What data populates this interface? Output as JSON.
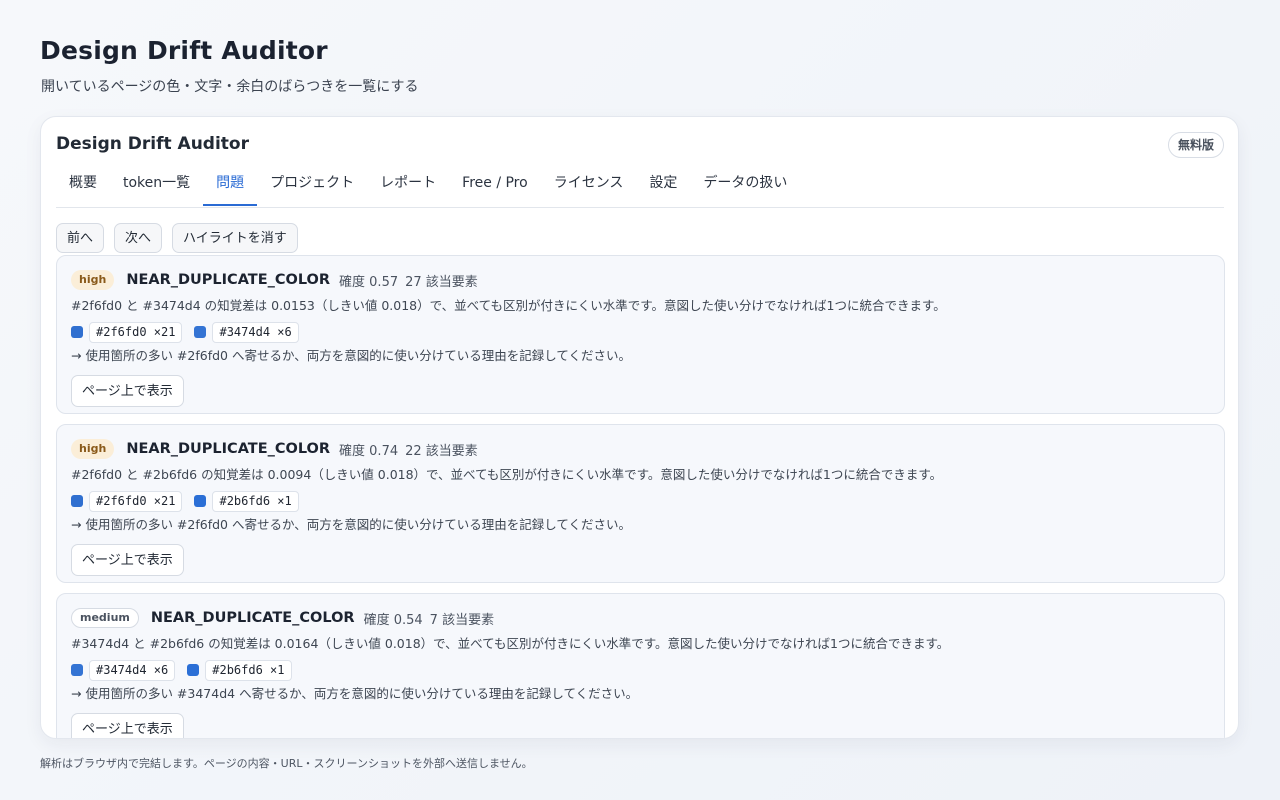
{
  "header": {
    "title": "Design Drift Auditor",
    "subtitle": "開いているページの色・文字・余白のばらつきを一覧にする"
  },
  "panel": {
    "title": "Design Drift Auditor",
    "plan_badge": "無料版",
    "tabs": [
      {
        "label": "概要"
      },
      {
        "label": "token一覧"
      },
      {
        "label": "問題",
        "active": true
      },
      {
        "label": "プロジェクト"
      },
      {
        "label": "レポート"
      },
      {
        "label": "Free / Pro"
      },
      {
        "label": "ライセンス"
      },
      {
        "label": "設定"
      },
      {
        "label": "データの扱い"
      }
    ],
    "toolbar": {
      "prev": "前へ",
      "next": "次へ",
      "clear_highlight": "ハイライトを消す"
    }
  },
  "issues": [
    {
      "severity": "high",
      "code": "NEAR_DUPLICATE_COLOR",
      "confidence": "確度 0.57",
      "elements": "27 該当要素",
      "description": "#2f6fd0 と #3474d4 の知覚差は 0.0153（しきい値 0.018）で、並べても区別が付きにくい水準です。意図した使い分けでなければ1つに統合できます。",
      "colors": [
        {
          "hex": "#2f6fd0",
          "label": "#2f6fd0 ×21",
          "swatch": "#2f6fd0"
        },
        {
          "hex": "#3474d4",
          "label": "#3474d4 ×6",
          "swatch": "#3474d4"
        }
      ],
      "suggestion": "→ 使用箇所の多い #2f6fd0 へ寄せるか、両方を意図的に使い分けている理由を記録してください。",
      "show_button": "ページ上で表示"
    },
    {
      "severity": "high",
      "code": "NEAR_DUPLICATE_COLOR",
      "confidence": "確度 0.74",
      "elements": "22 該当要素",
      "description": "#2f6fd0 と #2b6fd6 の知覚差は 0.0094（しきい値 0.018）で、並べても区別が付きにくい水準です。意図した使い分けでなければ1つに統合できます。",
      "colors": [
        {
          "hex": "#2f6fd0",
          "label": "#2f6fd0 ×21",
          "swatch": "#2f6fd0"
        },
        {
          "hex": "#2b6fd6",
          "label": "#2b6fd6 ×1",
          "swatch": "#2b6fd6"
        }
      ],
      "suggestion": "→ 使用箇所の多い #2f6fd0 へ寄せるか、両方を意図的に使い分けている理由を記録してください。",
      "show_button": "ページ上で表示"
    },
    {
      "severity": "medium",
      "code": "NEAR_DUPLICATE_COLOR",
      "confidence": "確度 0.54",
      "elements": "7 該当要素",
      "description": "#3474d4 と #2b6fd6 の知覚差は 0.0164（しきい値 0.018）で、並べても区別が付きにくい水準です。意図した使い分けでなければ1つに統合できます。",
      "colors": [
        {
          "hex": "#3474d4",
          "label": "#3474d4 ×6",
          "swatch": "#3474d4"
        },
        {
          "hex": "#2b6fd6",
          "label": "#2b6fd6 ×1",
          "swatch": "#2b6fd6"
        }
      ],
      "suggestion": "→ 使用箇所の多い #3474d4 へ寄せるか、両方を意図的に使い分けている理由を記録してください。",
      "show_button": "ページ上で表示"
    }
  ],
  "footer": {
    "note": "解析はブラウザ内で完結します。ページの内容・URL・スクリーンショットを外部へ送信しません。"
  },
  "theme": {
    "accent": "#2a6bd4",
    "high_badge_bg": "#fbeed8"
  }
}
